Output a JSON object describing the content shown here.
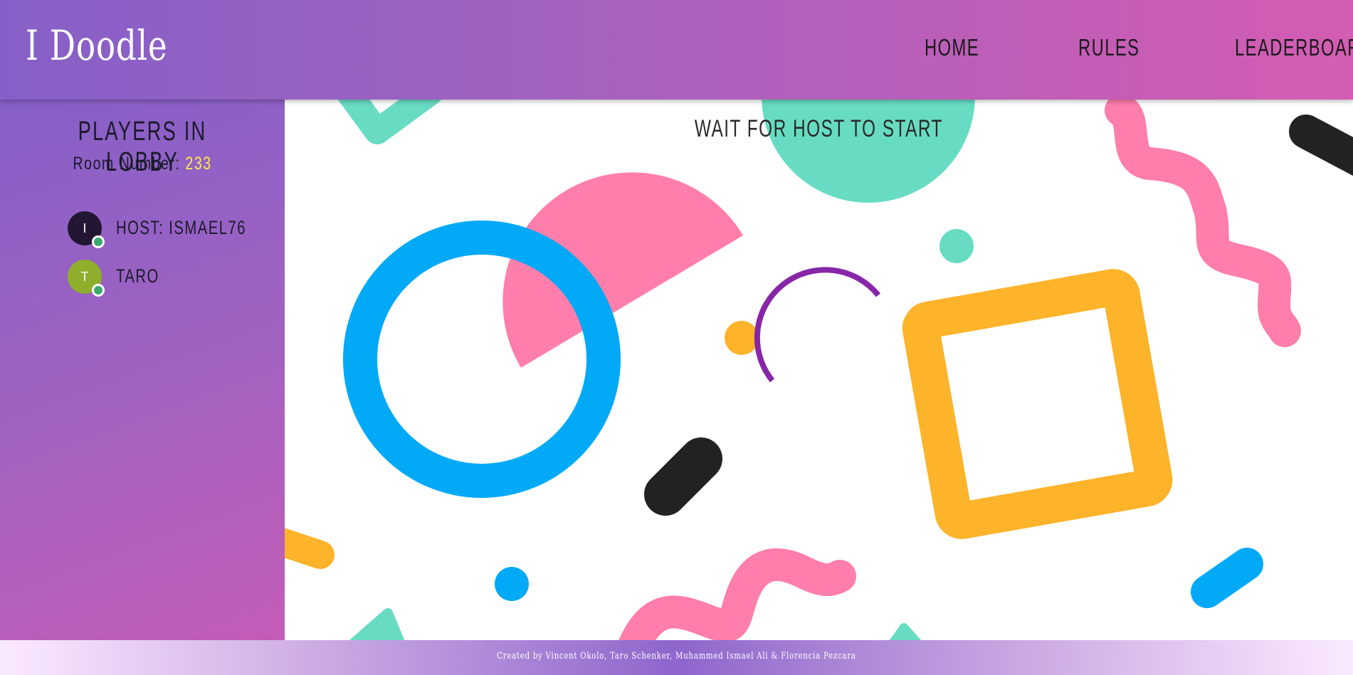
{
  "app": {
    "logo": "I Doodle"
  },
  "nav": {
    "home": "HOME",
    "rules": "RULES",
    "leaderboard": "LEADERBOARD"
  },
  "lobby": {
    "title": "PLAYERS IN LOBBY",
    "room_label": "Room Number:",
    "room_number": "233",
    "players": [
      {
        "initial": "I",
        "name": "HOST: ISMAEL76",
        "avatar_color": "#231632",
        "online": true
      },
      {
        "initial": "T",
        "name": "TARO",
        "avatar_color": "#8fae2c",
        "online": true
      }
    ]
  },
  "canvas": {
    "status": "WAIT FOR HOST TO START"
  },
  "footer": {
    "credits": "Created by Vincent Okolo, Taro Schenker, Muhammed Ismael Ali & Florencia Pezcara"
  },
  "colors": {
    "teal": "#68dbc3",
    "pink": "#ff7eab",
    "blue": "#02a9f7",
    "yellow": "#fdb32a",
    "purple": "#8727a8",
    "black": "#222222",
    "online_dot": "#3aaa6f",
    "room_number": "#ffe94a"
  }
}
